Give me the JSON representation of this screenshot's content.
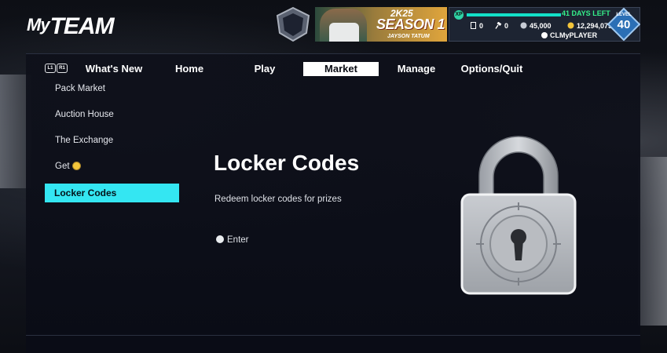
{
  "header": {
    "logo_text": "MyTEAM",
    "logo_prefix": "My",
    "logo_main": "TEAM",
    "season_banner": {
      "top": "2K25",
      "main": "SEASON 1",
      "sub": "JAYSON TATUM"
    },
    "status": {
      "days_left": "41 DAYS LEFT",
      "cards_count": "0",
      "auction_count": "0",
      "mt_amount": "45,000",
      "vc_amount": "12,294,075",
      "username": "CLMyPLAYER",
      "level_label": "LEVEL",
      "level": "40"
    }
  },
  "nav": {
    "bumper_left": "L1",
    "bumper_right": "R1",
    "tabs": [
      {
        "label": "What's New"
      },
      {
        "label": "Home"
      },
      {
        "label": "Play"
      },
      {
        "label": "Market"
      },
      {
        "label": "Manage"
      },
      {
        "label": "Options/Quit"
      }
    ],
    "active_tab": "Market"
  },
  "submenu": {
    "items": [
      {
        "label": "Pack Market"
      },
      {
        "label": "Auction House"
      },
      {
        "label": "The Exchange"
      },
      {
        "label": "Get"
      },
      {
        "label": "Locker Codes"
      }
    ],
    "selected": "Locker Codes"
  },
  "content": {
    "title": "Locker Codes",
    "description": "Redeem locker codes for prizes",
    "enter_label": "Enter"
  },
  "colors": {
    "accent": "#34e6f2",
    "active_tab_bg": "#ffffff",
    "days_left": "#35f08a"
  },
  "icons": {
    "padlock": "padlock-icon",
    "coin": "coin-icon",
    "enter_button": "controller-button-icon"
  }
}
